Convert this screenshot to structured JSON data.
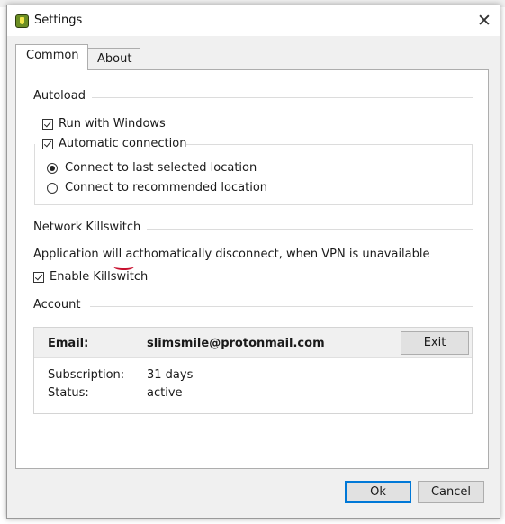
{
  "window": {
    "title": "Settings",
    "close_glyph": "✕"
  },
  "tabs": [
    {
      "label": "Common",
      "active": true
    },
    {
      "label": "About",
      "active": false
    }
  ],
  "autoload": {
    "title": "Autoload",
    "run_with_windows": {
      "label": "Run with Windows",
      "checked": true
    },
    "automatic_connection": {
      "label": "Automatic connection",
      "checked": true
    },
    "options": [
      {
        "label": "Connect to last selected location",
        "selected": true
      },
      {
        "label": "Connect to recommended location",
        "selected": false
      }
    ]
  },
  "killswitch": {
    "title": "Network Killswitch",
    "description": "Application will acthomatically disconnect, when VPN is unavailable",
    "enable": {
      "label": "Enable Killswitch",
      "checked": true
    }
  },
  "account": {
    "title": "Account",
    "email_label": "Email:",
    "email_value": "slimsmile@protonmail.com",
    "exit_label": "Exit",
    "subscription_label": "Subscription:",
    "subscription_value": "31 days",
    "status_label": "Status:",
    "status_value": "active"
  },
  "footer": {
    "ok_label": "Ok",
    "cancel_label": "Cancel"
  },
  "colors": {
    "accent": "#0078d7",
    "spellcheck_underline": "#c8102e",
    "app_icon": "#6b8e23"
  }
}
